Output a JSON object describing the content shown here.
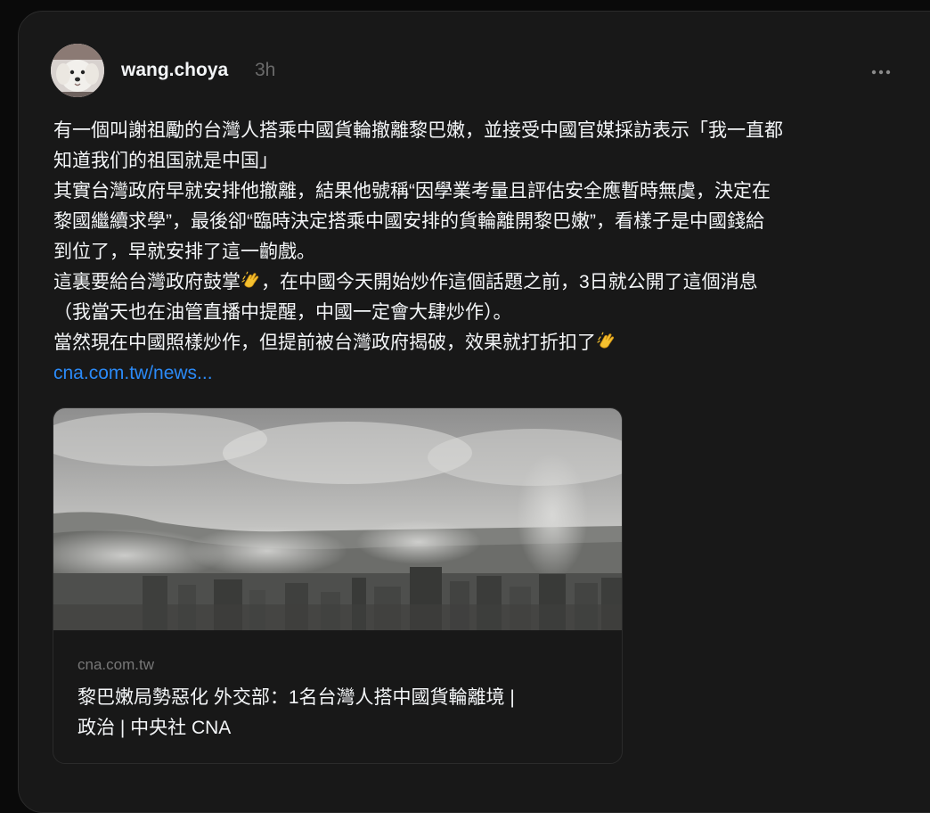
{
  "post": {
    "username": "wang.choya",
    "timestamp": "3h",
    "text_lines": [
      "有一個叫謝祖勵的台灣人搭乘中國貨輪撤離黎巴嫩，並接受中國官媒採訪表示「我一直都",
      "知道我们的祖国就是中国」",
      "其實台灣政府早就安排他撤離，結果他號稱“因學業考量且評估安全應暫時無虞，決定在",
      "黎國繼續求學”，最後卻“臨時決定搭乘中國安排的貨輪離開黎巴嫩”，看樣子是中國錢給",
      "到位了，早就安排了這一齣戲。",
      "這裏要給台灣政府鼓掌",
      "，在中國今天開始炒作這個話題之前，3日就公開了這個消息",
      "（我當天也在油管直播中提醒，中國一定會大肆炒作）。",
      "當然現在中國照樣炒作，但提前被台灣政府揭破，效果就打折扣了"
    ],
    "link_text": "cna.com.tw/news..."
  },
  "link_preview": {
    "domain": "cna.com.tw",
    "title_lines": [
      "黎巴嫩局勢惡化 外交部：1名台灣人搭中國貨輪離境 |",
      "政治 | 中央社 CNA"
    ]
  },
  "icons": {
    "more": "more-horizontal-icon",
    "emoji": "clapping-hands-emoji",
    "avatar": "dog-avatar"
  },
  "colors": {
    "background": "#0a0a0a",
    "card": "#181818",
    "text": "#f3f5f7",
    "muted": "#777777",
    "link": "#2b8af7"
  }
}
